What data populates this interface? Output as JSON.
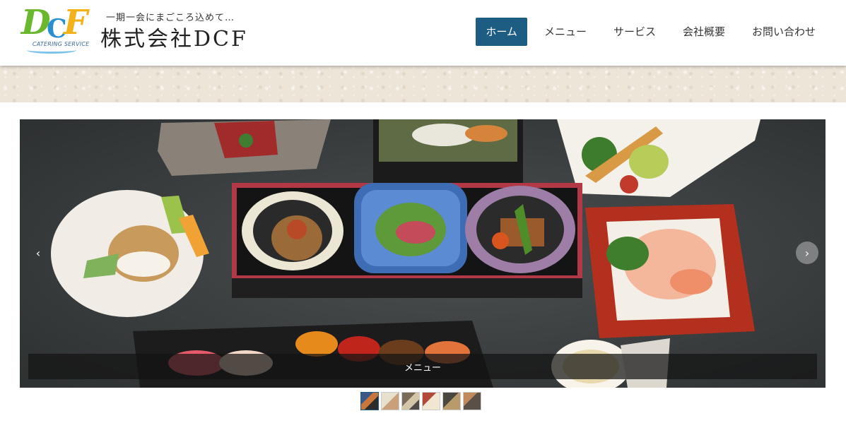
{
  "logo": {
    "mark_letters": [
      "D",
      "C",
      "F"
    ],
    "mark_subtitle": "CATERING SERVICE",
    "tagline": "一期一会にまごころ込めて…",
    "company_name": "株式会社DCF",
    "colors": {
      "d": "#6ab82e",
      "c": "#2a8fd0",
      "f": "#f3b21a"
    }
  },
  "nav": {
    "items": [
      {
        "label": "ホーム",
        "active": true
      },
      {
        "label": "メニュー",
        "active": false
      },
      {
        "label": "サービス",
        "active": false
      },
      {
        "label": "会社概要",
        "active": false
      },
      {
        "label": "お問い合わせ",
        "active": false
      }
    ],
    "active_color": "#1e5d83"
  },
  "slider": {
    "caption": "メニュー",
    "prev_icon": "chevron-left-icon",
    "next_icon": "chevron-right-icon",
    "prev_glyph": "‹",
    "next_glyph": "›",
    "thumbnail_count": 6,
    "active_thumbnail": 1
  }
}
